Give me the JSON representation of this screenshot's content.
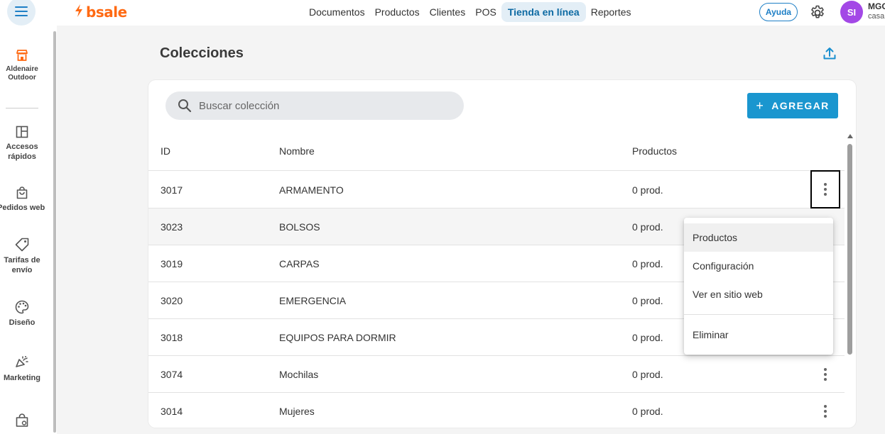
{
  "header": {
    "logo_text": "bsale",
    "nav": [
      {
        "label": "Documentos"
      },
      {
        "label": "Productos"
      },
      {
        "label": "Clientes"
      },
      {
        "label": "POS"
      },
      {
        "label": "Tienda en línea",
        "active": true
      },
      {
        "label": "Reportes"
      }
    ],
    "help_label": "Ayuda",
    "avatar_initials": "SI",
    "user_name": "MGC",
    "user_sub": "casa"
  },
  "sidebar": {
    "store_name": "Aldenaire Outdoor",
    "items": [
      {
        "label": "Accesos rápidos",
        "icon": "layout-icon"
      },
      {
        "label": "Pedidos web",
        "icon": "shopping-bag-icon"
      },
      {
        "label": "Tarifas de envío",
        "icon": "tag-icon"
      },
      {
        "label": "Diseño",
        "icon": "palette-icon"
      },
      {
        "label": "Marketing",
        "icon": "megaphone-icon"
      },
      {
        "label": "",
        "icon": "bag-settings-icon"
      }
    ]
  },
  "page": {
    "title": "Colecciones",
    "search_placeholder": "Buscar colección",
    "add_label": "AGREGAR",
    "columns": {
      "id": "ID",
      "name": "Nombre",
      "products": "Productos"
    },
    "rows": [
      {
        "id": "3017",
        "name": "ARMAMENTO",
        "products": "0 prod."
      },
      {
        "id": "3023",
        "name": "BOLSOS",
        "products": "0 prod."
      },
      {
        "id": "3019",
        "name": "CARPAS",
        "products": "0 prod."
      },
      {
        "id": "3020",
        "name": "EMERGENCIA",
        "products": "0 prod."
      },
      {
        "id": "3018",
        "name": "EQUIPOS PARA DORMIR",
        "products": "0 prod."
      },
      {
        "id": "3074",
        "name": "Mochilas",
        "products": "0 prod."
      },
      {
        "id": "3014",
        "name": "Mujeres",
        "products": "0 prod."
      }
    ]
  },
  "context_menu": {
    "items": [
      "Productos",
      "Configuración",
      "Ver en sitio web"
    ],
    "danger_item": "Eliminar"
  },
  "colors": {
    "brand": "#ff6a13",
    "accent": "#1a96cf",
    "avatar": "#a348e6"
  }
}
